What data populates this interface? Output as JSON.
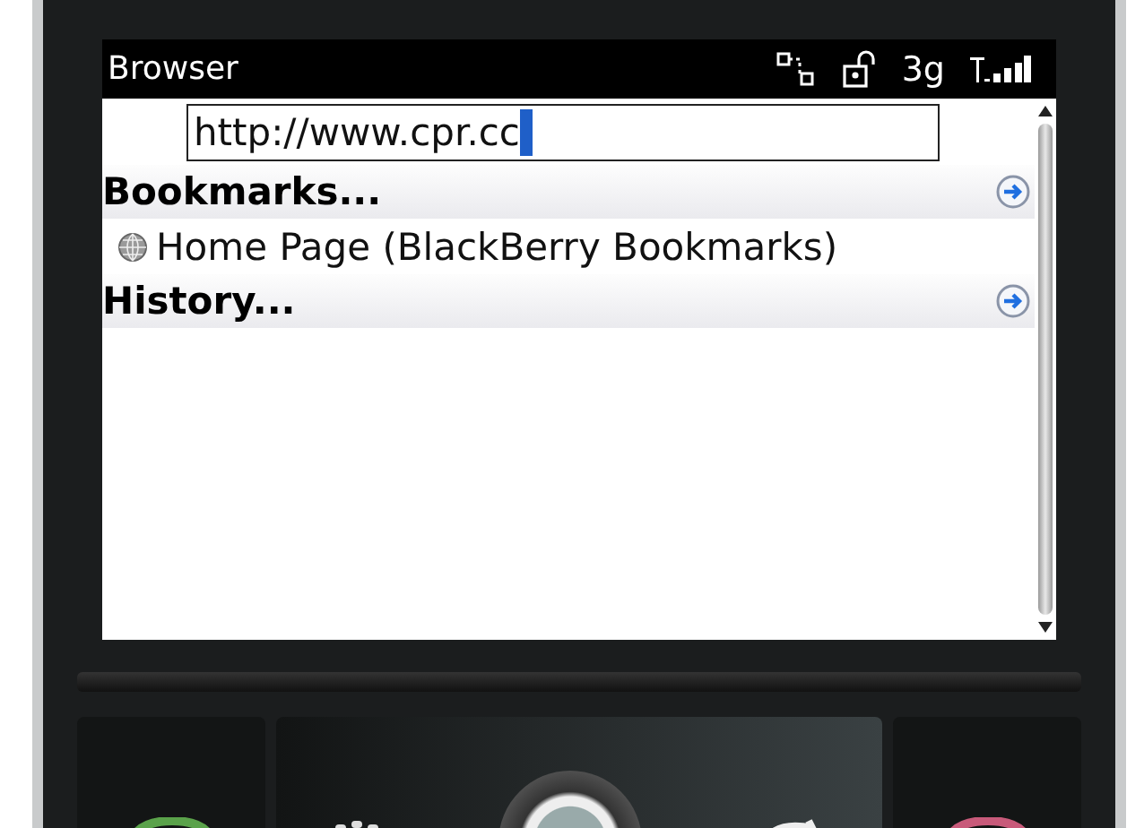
{
  "status_bar": {
    "title": "Browser",
    "network": "3g"
  },
  "address_field": {
    "value": "http://www.cpr.cc"
  },
  "sections": [
    {
      "title": "Bookmarks...",
      "items": [
        {
          "label": "Home Page (BlackBerry Bookmarks)"
        }
      ]
    },
    {
      "title": "History..."
    }
  ]
}
